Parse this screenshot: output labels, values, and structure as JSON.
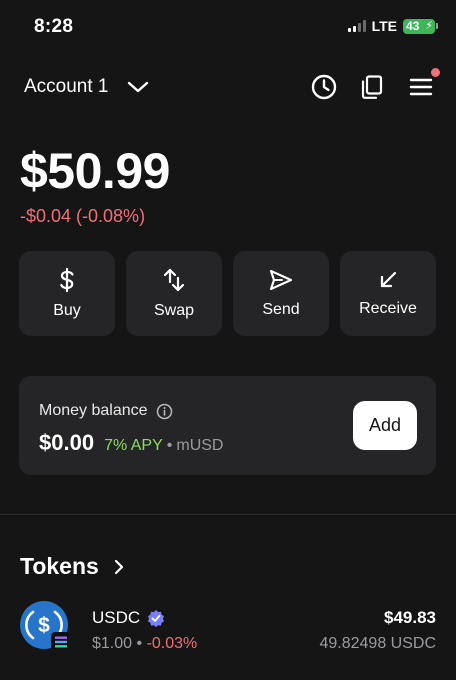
{
  "status_bar": {
    "time": "8:28",
    "network": "LTE",
    "battery": "43"
  },
  "header": {
    "account_name": "Account 1"
  },
  "portfolio": {
    "balance": "$50.99",
    "change": "-$0.04 (-0.08%)"
  },
  "actions": [
    {
      "label": "Buy",
      "icon": "dollar-icon"
    },
    {
      "label": "Swap",
      "icon": "swap-arrows-icon"
    },
    {
      "label": "Send",
      "icon": "send-icon"
    },
    {
      "label": "Receive",
      "icon": "receive-arrow-icon"
    }
  ],
  "money_balance": {
    "title": "Money balance",
    "amount": "$0.00",
    "apy": "7% APY",
    "separator": "•",
    "currency": "mUSD",
    "add_label": "Add"
  },
  "tokens": {
    "title": "Tokens",
    "items": [
      {
        "name": "USDC",
        "price": "$1.00",
        "separator": "•",
        "change": "-0.03%",
        "value": "$49.83",
        "quantity": "49.82498 USDC"
      }
    ]
  },
  "colors": {
    "background": "#151516",
    "card": "#252527",
    "negative": "#ef6f77",
    "apy_green": "#8cdc5d",
    "usdc_blue": "#2775ca",
    "verified_purple": "#7b7ff6"
  }
}
